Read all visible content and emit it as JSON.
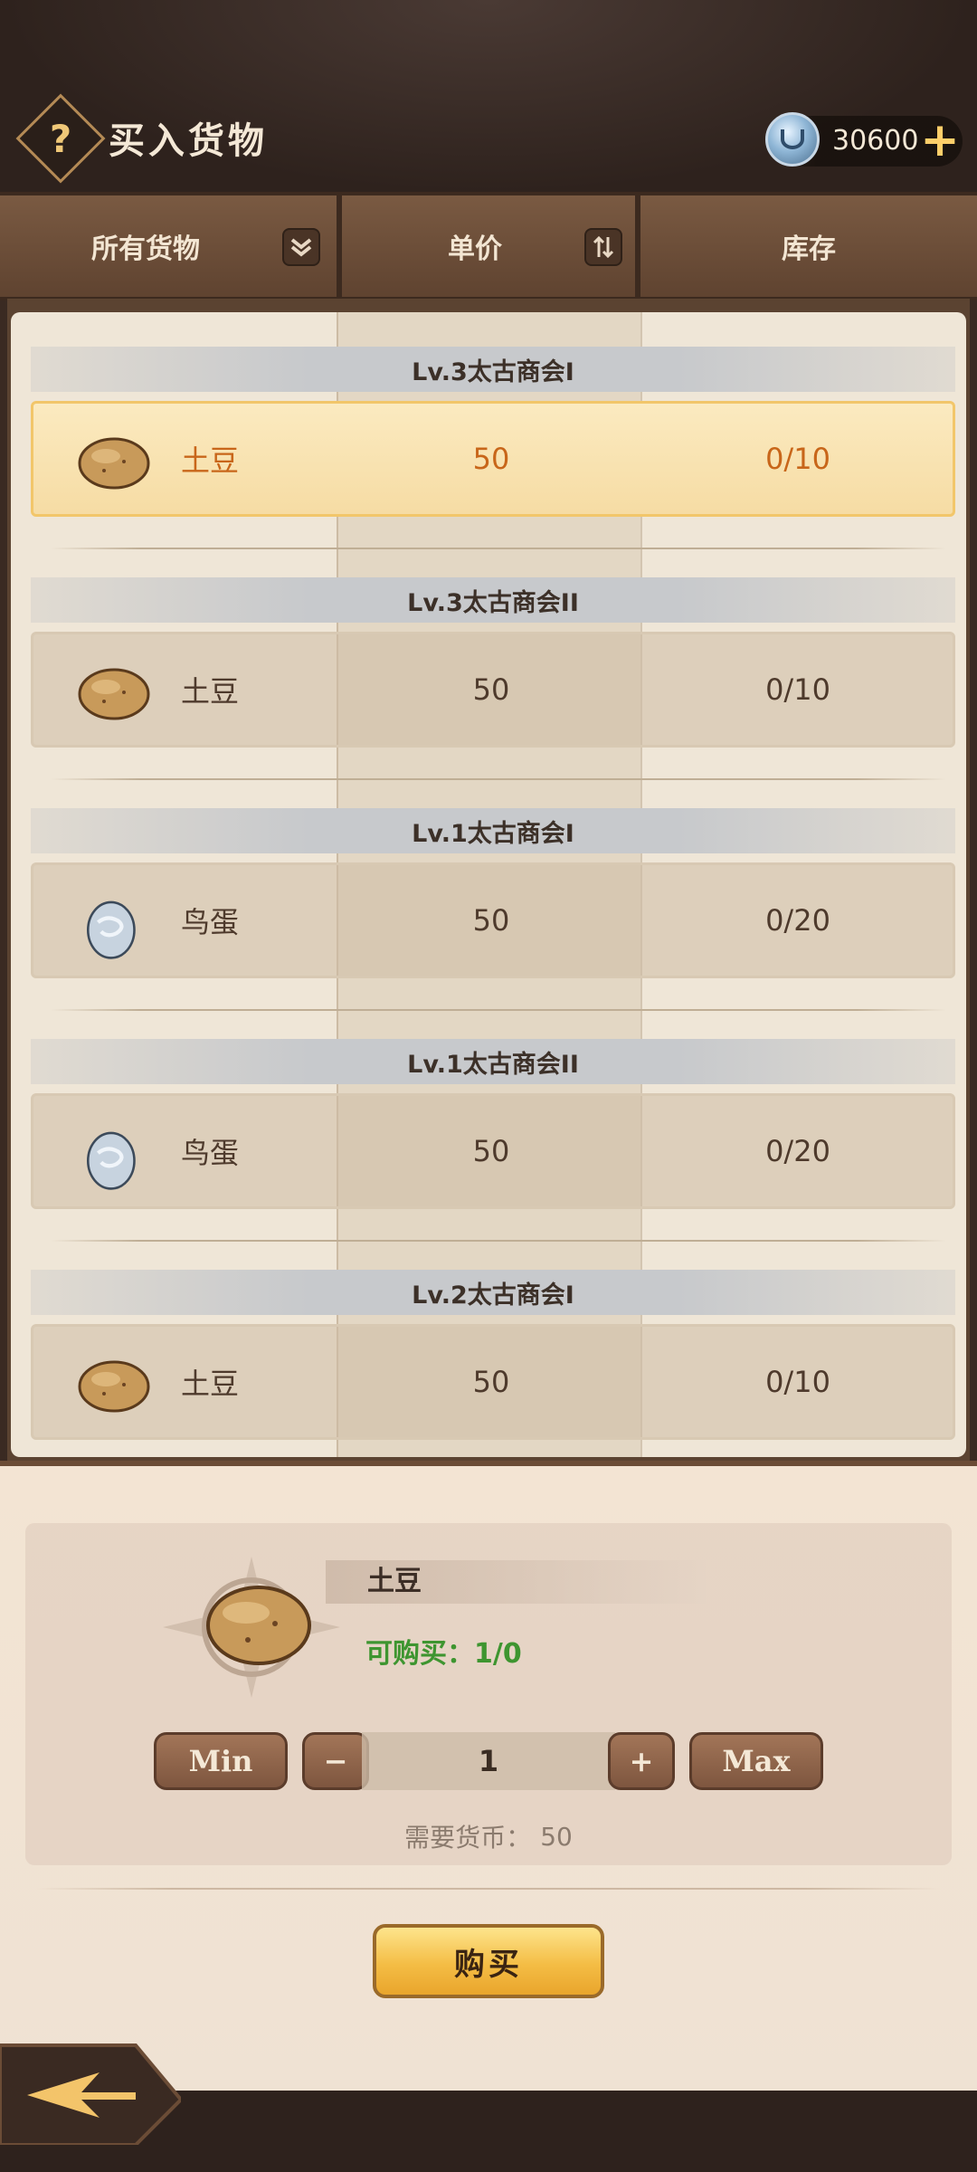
{
  "header": {
    "title": "买入货物",
    "currency_value": "30600"
  },
  "columns": {
    "filter_label": "所有货物",
    "price_label": "单价",
    "stock_label": "库存"
  },
  "groups": [
    {
      "title": "Lv.3太古商会I",
      "item": {
        "name": "土豆",
        "icon": "potato-icon",
        "price": "50",
        "stock": "0/10",
        "selected": true
      }
    },
    {
      "title": "Lv.3太古商会II",
      "item": {
        "name": "土豆",
        "icon": "potato-icon",
        "price": "50",
        "stock": "0/10",
        "selected": false
      }
    },
    {
      "title": "Lv.1太古商会I",
      "item": {
        "name": "鸟蛋",
        "icon": "egg-icon",
        "price": "50",
        "stock": "0/20",
        "selected": false
      }
    },
    {
      "title": "Lv.1太古商会II",
      "item": {
        "name": "鸟蛋",
        "icon": "egg-icon",
        "price": "50",
        "stock": "0/20",
        "selected": false
      }
    },
    {
      "title": "Lv.2太古商会I",
      "item": {
        "name": "土豆",
        "icon": "potato-icon",
        "price": "50",
        "stock": "0/10",
        "selected": false
      }
    }
  ],
  "detail": {
    "name": "土豆",
    "limit_text": "可购买：1/0",
    "min_label": "Min",
    "minus_label": "−",
    "quantity": "1",
    "plus_label": "+",
    "max_label": "Max",
    "cost_label": "需要货币：",
    "cost_value": "50",
    "buy_label": "购买"
  },
  "colors": {
    "accent_gold": "#f4bd45",
    "selected_text": "#c8661a",
    "limit_green": "#3e9530"
  }
}
